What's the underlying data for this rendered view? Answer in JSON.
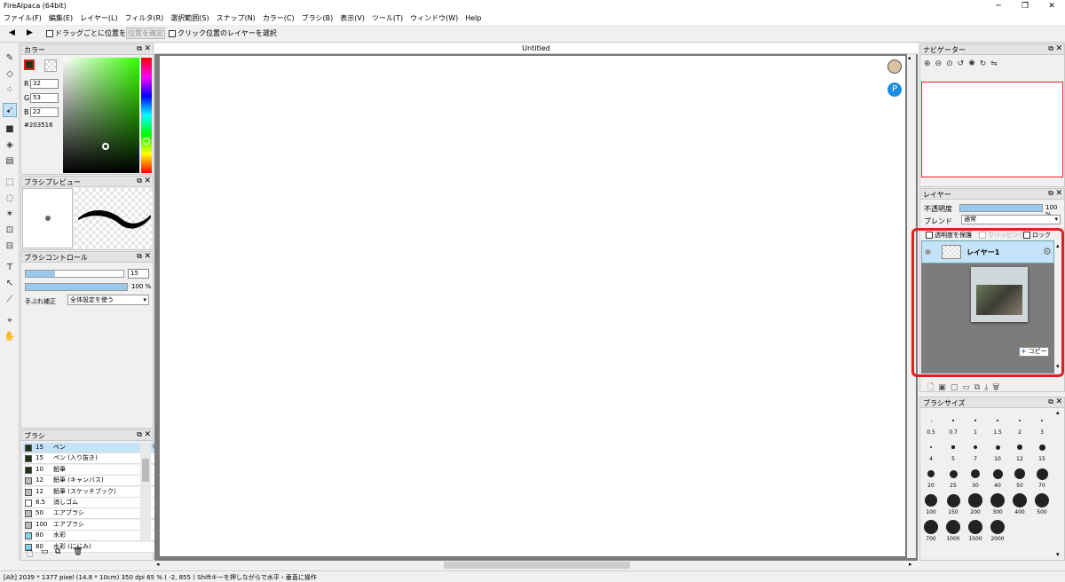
{
  "window": {
    "title": "FireAlpaca (64bit)"
  },
  "menu": [
    "ファイル(F)",
    "編集(E)",
    "レイヤー(L)",
    "フィルタ(R)",
    "選択範囲(S)",
    "スナップ(N)",
    "カラー(C)",
    "ブラシ(B)",
    "表示(V)",
    "ツール(T)",
    "ウィンドウ(W)",
    "Help"
  ],
  "toolbar": {
    "drag_confirm": "ドラッグごとに位置を確定",
    "confirm_pos": "位置を確定",
    "click_select_layer": "クリック位置のレイヤーを選択"
  },
  "color_panel": {
    "title": "カラー",
    "r_label": "R",
    "r": "32",
    "g_label": "G",
    "g": "53",
    "b_label": "B",
    "b": "22",
    "hex": "#203516",
    "fg_color": "#203516"
  },
  "brush_preview": {
    "title": "ブラシプレビュー"
  },
  "brush_control": {
    "title": "ブラシコントロール",
    "size": "15",
    "size_fraction": 0.3,
    "opacity": "100 %",
    "opacity_fraction": 1.0,
    "stabilizer_label": "手ぶれ補正",
    "stabilizer_value": "全体設定を使う"
  },
  "brush_panel": {
    "title": "ブラシ",
    "items": [
      {
        "size": "15",
        "name": "ペン",
        "color": "#203516",
        "selected": true
      },
      {
        "size": "15",
        "name": "ペン (入り抜き)",
        "color": "#203516"
      },
      {
        "size": "10",
        "name": "鉛筆",
        "color": "#203516"
      },
      {
        "size": "12",
        "name": "鉛筆 (キャンバス)",
        "color": "#bbbbbb"
      },
      {
        "size": "12",
        "name": "鉛筆 (スケッチブック)",
        "color": "#bbbbbb"
      },
      {
        "size": "8.5",
        "name": "消しゴム",
        "color": "#ffffff"
      },
      {
        "size": "50",
        "name": "エアブラシ",
        "color": "#bbbbbb"
      },
      {
        "size": "100",
        "name": "エアブラシ",
        "color": "#bbbbbb"
      },
      {
        "size": "80",
        "name": "水彩",
        "color": "#7fd3ea"
      },
      {
        "size": "80",
        "name": "水彩 (にじみ)",
        "color": "#7fd3ea"
      }
    ]
  },
  "canvas": {
    "tab_title": "Untitled"
  },
  "navigator": {
    "title": "ナビゲーター"
  },
  "layer_panel": {
    "title": "レイヤー",
    "opacity_label": "不透明度",
    "opacity": "100 %",
    "blend_label": "ブレンド",
    "blend_value": "通常",
    "preserve_label": "透明度を保護",
    "clipping_label": "クリッピング",
    "lock_label": "ロック",
    "layer_name": "レイヤー1",
    "copy_label": "コピー"
  },
  "brush_size_panel": {
    "title": "ブラシサイズ",
    "sizes": [
      "0.5",
      "0.7",
      "1",
      "1.5",
      "2",
      "3",
      "4",
      "5",
      "7",
      "10",
      "12",
      "15",
      "20",
      "25",
      "30",
      "40",
      "50",
      "70",
      "100",
      "150",
      "200",
      "300",
      "400",
      "500",
      "700",
      "1000",
      "1500",
      "2000"
    ]
  },
  "status": {
    "text": "[Alt]  2039 * 1377 pixel  (14.8 * 10cm)  350 dpi  65 %  ( -2, 855 )  Shiftキーを押しながらで水平・垂直に操作"
  },
  "colors": {
    "accent": "#9bc9ec",
    "highlight": "#e02020",
    "selected_row": "#c5e3f8"
  }
}
